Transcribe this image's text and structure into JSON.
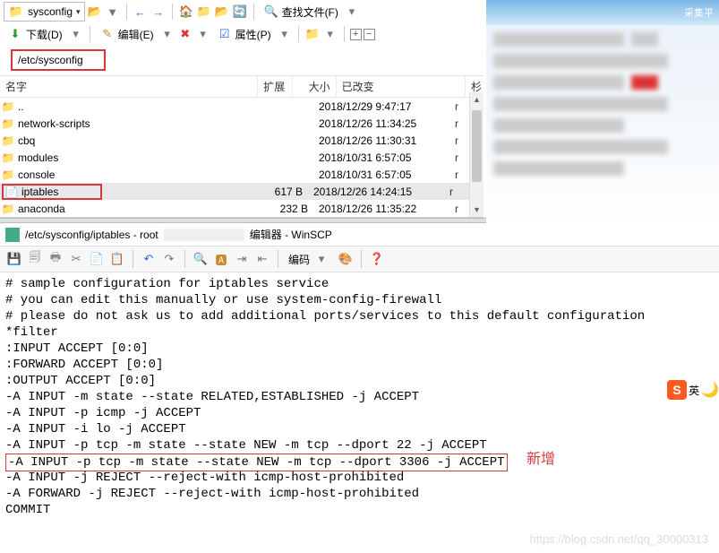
{
  "toolbar1": {
    "folder_dd": "sysconfig",
    "find_files": "查找文件(F)"
  },
  "toolbar2": {
    "download": "下载(D)",
    "edit": "编辑(E)",
    "props": "属性(P)"
  },
  "address": "/etc/sysconfig",
  "columns": {
    "name": "名字",
    "ext": "扩展",
    "size": "大小",
    "changed": "已改变",
    "flag": "杉"
  },
  "rows": [
    {
      "icon": "📁",
      "name": "..",
      "size": "",
      "date": "2018/12/29 9:47:17",
      "flag": "r"
    },
    {
      "icon": "📁",
      "name": "network-scripts",
      "size": "",
      "date": "2018/12/26 11:34:25",
      "flag": "r"
    },
    {
      "icon": "📁",
      "name": "cbq",
      "size": "",
      "date": "2018/12/26 11:30:31",
      "flag": "r"
    },
    {
      "icon": "📁",
      "name": "modules",
      "size": "",
      "date": "2018/10/31 6:57:05",
      "flag": "r"
    },
    {
      "icon": "📁",
      "name": "console",
      "size": "",
      "date": "2018/10/31 6:57:05",
      "flag": "r"
    },
    {
      "icon": "📄",
      "name": "iptables",
      "size": "617 B",
      "date": "2018/12/26 14:24:15",
      "flag": "r",
      "highlight": true,
      "selected": true
    },
    {
      "icon": "📁",
      "name": "anaconda",
      "size": "232 B",
      "date": "2018/12/26 11:35:22",
      "flag": "r"
    }
  ],
  "editor": {
    "title_prefix": "/etc/sysconfig/iptables - root",
    "title_suffix": "编辑器 - WinSCP",
    "encode_label": "编码"
  },
  "code_lines": [
    "# sample configuration for iptables service",
    "# you can edit this manually or use system-config-firewall",
    "# please do not ask us to add additional ports/services to this default configuration",
    "*filter",
    ":INPUT ACCEPT [0:0]",
    ":FORWARD ACCEPT [0:0]",
    ":OUTPUT ACCEPT [0:0]",
    "-A INPUT -m state --state RELATED,ESTABLISHED -j ACCEPT",
    "-A INPUT -p icmp -j ACCEPT",
    "-A INPUT -i lo -j ACCEPT",
    "-A INPUT -p tcp -m state --state NEW -m tcp --dport 22 -j ACCEPT",
    "-A INPUT -p tcp -m state --state NEW -m tcp --dport 3306 -j ACCEPT",
    "-A INPUT -j REJECT --reject-with icmp-host-prohibited",
    "-A FORWARD -j REJECT --reject-with icmp-host-prohibited",
    "COMMIT"
  ],
  "highlight_line_index": 11,
  "new_tag": "新增",
  "sky_label": "采集平",
  "side_badge_text": "英",
  "watermark": "https://blog.csdn.net/qq_30000313"
}
